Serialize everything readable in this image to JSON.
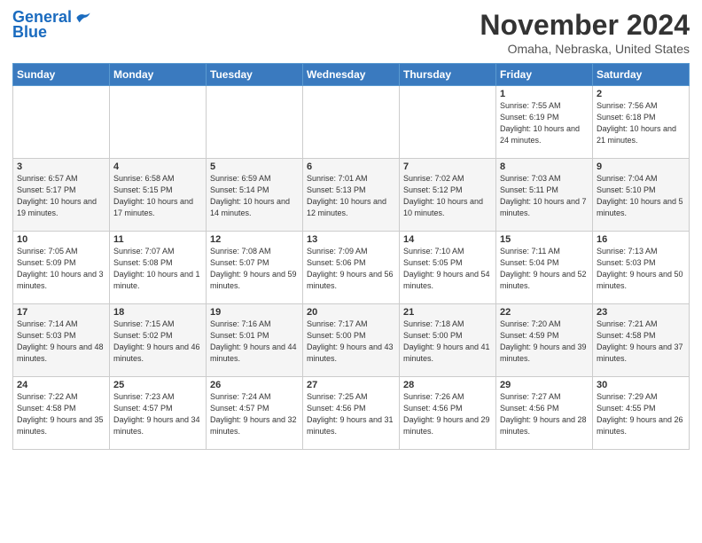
{
  "header": {
    "logo_line1": "General",
    "logo_line2": "Blue",
    "month_title": "November 2024",
    "location": "Omaha, Nebraska, United States"
  },
  "days_of_week": [
    "Sunday",
    "Monday",
    "Tuesday",
    "Wednesday",
    "Thursday",
    "Friday",
    "Saturday"
  ],
  "weeks": [
    [
      {
        "day": "",
        "info": ""
      },
      {
        "day": "",
        "info": ""
      },
      {
        "day": "",
        "info": ""
      },
      {
        "day": "",
        "info": ""
      },
      {
        "day": "",
        "info": ""
      },
      {
        "day": "1",
        "info": "Sunrise: 7:55 AM\nSunset: 6:19 PM\nDaylight: 10 hours and 24 minutes."
      },
      {
        "day": "2",
        "info": "Sunrise: 7:56 AM\nSunset: 6:18 PM\nDaylight: 10 hours and 21 minutes."
      }
    ],
    [
      {
        "day": "3",
        "info": "Sunrise: 6:57 AM\nSunset: 5:17 PM\nDaylight: 10 hours and 19 minutes."
      },
      {
        "day": "4",
        "info": "Sunrise: 6:58 AM\nSunset: 5:15 PM\nDaylight: 10 hours and 17 minutes."
      },
      {
        "day": "5",
        "info": "Sunrise: 6:59 AM\nSunset: 5:14 PM\nDaylight: 10 hours and 14 minutes."
      },
      {
        "day": "6",
        "info": "Sunrise: 7:01 AM\nSunset: 5:13 PM\nDaylight: 10 hours and 12 minutes."
      },
      {
        "day": "7",
        "info": "Sunrise: 7:02 AM\nSunset: 5:12 PM\nDaylight: 10 hours and 10 minutes."
      },
      {
        "day": "8",
        "info": "Sunrise: 7:03 AM\nSunset: 5:11 PM\nDaylight: 10 hours and 7 minutes."
      },
      {
        "day": "9",
        "info": "Sunrise: 7:04 AM\nSunset: 5:10 PM\nDaylight: 10 hours and 5 minutes."
      }
    ],
    [
      {
        "day": "10",
        "info": "Sunrise: 7:05 AM\nSunset: 5:09 PM\nDaylight: 10 hours and 3 minutes."
      },
      {
        "day": "11",
        "info": "Sunrise: 7:07 AM\nSunset: 5:08 PM\nDaylight: 10 hours and 1 minute."
      },
      {
        "day": "12",
        "info": "Sunrise: 7:08 AM\nSunset: 5:07 PM\nDaylight: 9 hours and 59 minutes."
      },
      {
        "day": "13",
        "info": "Sunrise: 7:09 AM\nSunset: 5:06 PM\nDaylight: 9 hours and 56 minutes."
      },
      {
        "day": "14",
        "info": "Sunrise: 7:10 AM\nSunset: 5:05 PM\nDaylight: 9 hours and 54 minutes."
      },
      {
        "day": "15",
        "info": "Sunrise: 7:11 AM\nSunset: 5:04 PM\nDaylight: 9 hours and 52 minutes."
      },
      {
        "day": "16",
        "info": "Sunrise: 7:13 AM\nSunset: 5:03 PM\nDaylight: 9 hours and 50 minutes."
      }
    ],
    [
      {
        "day": "17",
        "info": "Sunrise: 7:14 AM\nSunset: 5:03 PM\nDaylight: 9 hours and 48 minutes."
      },
      {
        "day": "18",
        "info": "Sunrise: 7:15 AM\nSunset: 5:02 PM\nDaylight: 9 hours and 46 minutes."
      },
      {
        "day": "19",
        "info": "Sunrise: 7:16 AM\nSunset: 5:01 PM\nDaylight: 9 hours and 44 minutes."
      },
      {
        "day": "20",
        "info": "Sunrise: 7:17 AM\nSunset: 5:00 PM\nDaylight: 9 hours and 43 minutes."
      },
      {
        "day": "21",
        "info": "Sunrise: 7:18 AM\nSunset: 5:00 PM\nDaylight: 9 hours and 41 minutes."
      },
      {
        "day": "22",
        "info": "Sunrise: 7:20 AM\nSunset: 4:59 PM\nDaylight: 9 hours and 39 minutes."
      },
      {
        "day": "23",
        "info": "Sunrise: 7:21 AM\nSunset: 4:58 PM\nDaylight: 9 hours and 37 minutes."
      }
    ],
    [
      {
        "day": "24",
        "info": "Sunrise: 7:22 AM\nSunset: 4:58 PM\nDaylight: 9 hours and 35 minutes."
      },
      {
        "day": "25",
        "info": "Sunrise: 7:23 AM\nSunset: 4:57 PM\nDaylight: 9 hours and 34 minutes."
      },
      {
        "day": "26",
        "info": "Sunrise: 7:24 AM\nSunset: 4:57 PM\nDaylight: 9 hours and 32 minutes."
      },
      {
        "day": "27",
        "info": "Sunrise: 7:25 AM\nSunset: 4:56 PM\nDaylight: 9 hours and 31 minutes."
      },
      {
        "day": "28",
        "info": "Sunrise: 7:26 AM\nSunset: 4:56 PM\nDaylight: 9 hours and 29 minutes."
      },
      {
        "day": "29",
        "info": "Sunrise: 7:27 AM\nSunset: 4:56 PM\nDaylight: 9 hours and 28 minutes."
      },
      {
        "day": "30",
        "info": "Sunrise: 7:29 AM\nSunset: 4:55 PM\nDaylight: 9 hours and 26 minutes."
      }
    ]
  ]
}
